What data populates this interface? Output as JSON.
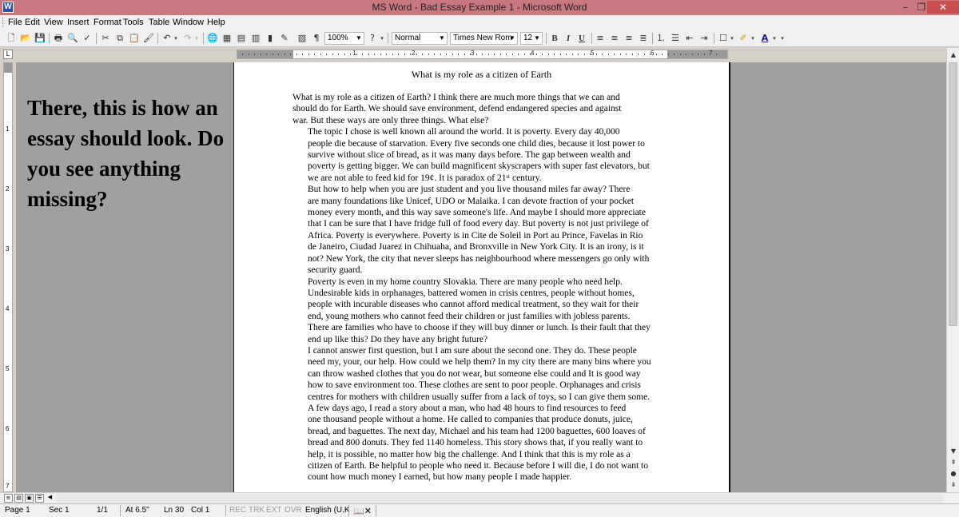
{
  "window": {
    "title": "MS Word - Bad Essay Example 1 - Microsoft Word",
    "minimize": "–",
    "restore": "❐",
    "close": "✕"
  },
  "menu": [
    "File",
    "Edit",
    "View",
    "Insert",
    "Format",
    "Tools",
    "Table",
    "Window",
    "Help"
  ],
  "toolbar": {
    "zoom": "100%",
    "style": "Normal",
    "font": "Times New Rom",
    "size": "12",
    "bold": "B",
    "italic": "I",
    "underline": "U",
    "text_color_glyph": "A",
    "pilcrow": "¶",
    "help": "?"
  },
  "ruler": {
    "corner": "L",
    "h_numbers": [
      "1",
      "2",
      "3",
      "4",
      "5",
      "6",
      "7"
    ],
    "v_numbers": [
      "1",
      "2",
      "3",
      "4",
      "5",
      "6",
      "7"
    ]
  },
  "annotation": "There, this is how an essay should look. Do you see anything missing?",
  "document": {
    "title": "What is my role as a citizen of Earth",
    "paragraphs": [
      [
        "What is my role as a citizen of Earth? I think there are much more things that we can and",
        "should do for Earth. We should save environment, defend endangered species and against",
        "war. But these ways are only three things. What else?"
      ],
      [
        "The topic I chose is well known all around the world. It is poverty. Every day 40,000",
        "people die because of starvation. Every five seconds one child dies, because it lost power to",
        "survive without slice of bread, as it was many days before. The gap between wealth and",
        "poverty is getting bigger. We can build magnificent skyscrapers with super fast elevators, but",
        "we are not able to feed kid for 19¢. It is paradox of 21ˢᵗ century."
      ],
      [
        "But how to help when you are just student and you live thousand miles far away? There",
        "are many foundations like Unicef, UDO or Malaika. I can devote fraction of your pocket",
        "money every month, and this way save someone's life. And maybe I should more appreciate",
        "that I can be sure that I have fridge full of food every day. But poverty is not just privilege of",
        "Africa. Poverty is everywhere.  Poverty is in Cite de Soleil in Port au Prince, Favelas in Rio",
        "de Janeiro, Ciudad Juarez in Chihuaha, and Bronxville in New York City. It is an irony, is it",
        "not? New York, the city that never sleeps has neighbourhood where messengers go only with",
        "security guard."
      ],
      [
        "Poverty is even in my home country Slovakia. There are many people who need help.",
        "Undesirable kids in orphanages, battered women in crisis centres, people without homes,",
        "people with incurable diseases who cannot afford medical treatment, so they wait for their",
        "end, young mothers who cannot feed their children or just families with jobless parents.",
        "There are families who have to choose if they will buy dinner or lunch. Is their fault that they",
        "end up like this? Do they have any bright future?"
      ],
      [
        "I cannot answer first question, but I am sure about the second one. They do. These people",
        "need my, your, our help. How could we help them?  In my city there are many bins where you",
        "can throw washed clothes that you do not wear, but someone else could and It is good way",
        "how to save environment too. These clothes are sent to poor people. Orphanages and crisis",
        "centres for mothers with children usually suffer from a lack of toys, so I can give them some."
      ],
      [
        "A few days ago, I read a story about a man, who had 48 hours to find resources to feed",
        "one thousand people without a home. He called to companies that produce donuts, juice,",
        "bread, and baguettes.  The next day, Michael and his team had 1200 baguettes, 600 loaves of",
        "bread and 800 donuts. They fed 1140 homeless. This story shows that, if you really want to",
        "help, it is possible, no matter how big the challenge.  And I think that this is my role as a",
        "citizen of Earth. Be helpful to people who need it. Because before I will die, I do not want to",
        "count how much money I earned, but how many people I made happier."
      ]
    ]
  },
  "status": {
    "page": "Page 1",
    "sec": "Sec 1",
    "pages": "1/1",
    "at": "At 6.5\"",
    "ln": "Ln 30",
    "col": "Col 1",
    "rec": "REC",
    "trk": "TRK",
    "ext": "EXT",
    "ovr": "OVR",
    "language": "English (U.K"
  }
}
